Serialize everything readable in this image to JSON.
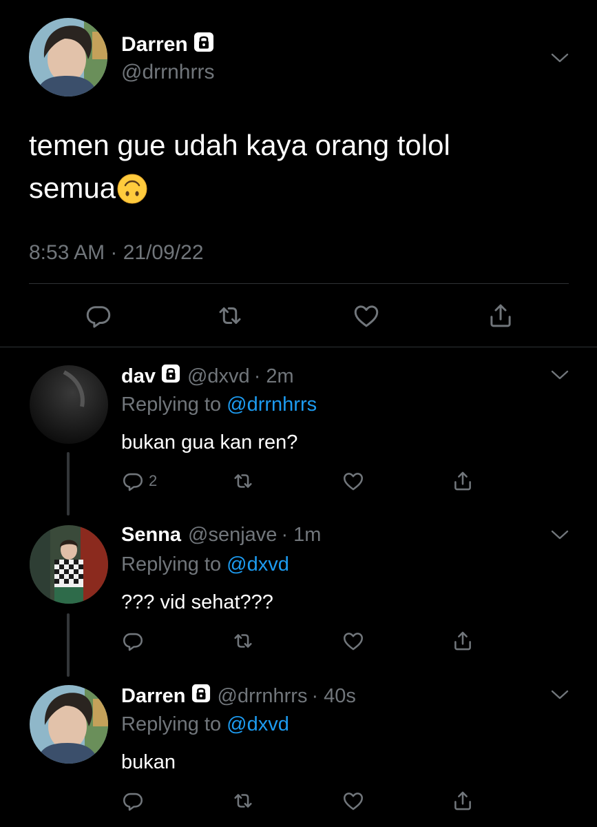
{
  "main_tweet": {
    "name": "Darren",
    "handle": "@drrnhrrs",
    "text_line1": "temen gue udah kaya orang tolol",
    "text_line2": "semua",
    "emoji": "🙃",
    "timestamp": "8:53 AM · 21/09/22"
  },
  "replies": [
    {
      "name": "dav",
      "handle": "@dxvd",
      "time": "· 2m",
      "replying_prefix": "Replying to",
      "replying_to": "@drrnhrrs",
      "text": "bukan gua kan ren?",
      "reply_count": "2",
      "locked": true
    },
    {
      "name": "Senna",
      "handle": "@senjave",
      "time": "· 1m",
      "replying_prefix": "Replying to",
      "replying_to": "@dxvd",
      "text": "??? vid sehat???",
      "reply_count": "",
      "locked": false
    },
    {
      "name": "Darren",
      "handle": "@drrnhrrs",
      "time": "· 40s",
      "replying_prefix": "Replying to",
      "replying_to": "@dxvd",
      "text": "bukan",
      "reply_count": "",
      "locked": true
    }
  ],
  "icons": {
    "lock": "lock-icon",
    "reply": "reply-icon",
    "retweet": "retweet-icon",
    "like": "heart-icon",
    "share": "share-icon",
    "more": "chevron-down-icon"
  },
  "colors": {
    "background": "#000000",
    "text": "#ffffff",
    "muted": "#71767b",
    "link": "#1d9bf0",
    "divider": "#2f3336"
  }
}
